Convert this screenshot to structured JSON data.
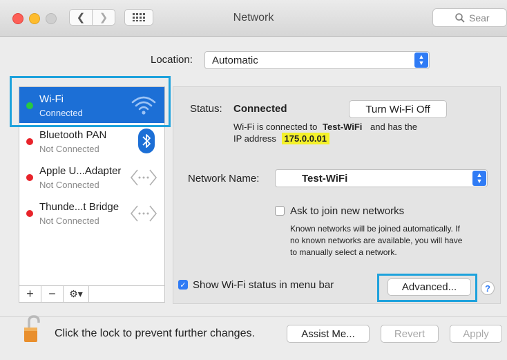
{
  "window": {
    "title": "Network",
    "search_placeholder": "Sear"
  },
  "location": {
    "label": "Location:",
    "value": "Automatic"
  },
  "services": [
    {
      "name": "Wi-Fi",
      "status": "Connected",
      "dot": "#28c840",
      "icon": "wifi-icon",
      "selected": true
    },
    {
      "name": "Bluetooth PAN",
      "status": "Not Connected",
      "dot": "#e8232a",
      "icon": "bluetooth-icon"
    },
    {
      "name": "Apple U...Adapter",
      "status": "Not Connected",
      "dot": "#e8232a",
      "icon": "ethernet-arrows-icon"
    },
    {
      "name": "Thunde...t Bridge",
      "status": "Not Connected",
      "dot": "#e8232a",
      "icon": "ethernet-arrows-icon"
    }
  ],
  "sidebar_tools": {
    "add": "+",
    "remove": "−",
    "gear": "⚙▾"
  },
  "detail": {
    "status_label": "Status:",
    "status_value": "Connected",
    "turn_off_button": "Turn Wi-Fi Off",
    "desc_line1_a": "Wi-Fi is connected to",
    "desc_ssid": "Test-WiFi",
    "desc_line1_b": "and has the",
    "desc_line2_a": "IP address",
    "ip_address": "175.0.0.01",
    "network_name_label": "Network Name:",
    "network_name_value": "Test-WiFi",
    "ask_join_label": "Ask to join new networks",
    "ask_join_help_1": "Known networks will be joined automatically. If",
    "ask_join_help_2": "no known networks are available, you will have",
    "ask_join_help_3": "to manually select a network.",
    "show_status_label": "Show Wi-Fi status in menu bar",
    "advanced_button": "Advanced...",
    "help_button": "?"
  },
  "bottom": {
    "lock_text": "Click the lock to prevent further changes.",
    "assist_button": "Assist Me...",
    "revert_button": "Revert",
    "apply_button": "Apply"
  },
  "colors": {
    "accent": "#1c6fd6",
    "highlight_box": "#1ea2dc",
    "ip_highlight": "#f4f12a"
  }
}
